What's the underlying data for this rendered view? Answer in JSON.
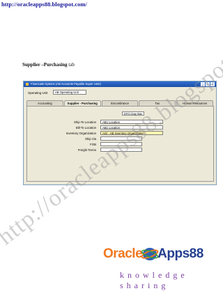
{
  "header": {
    "url": "http://oracleapps88.blogspot.com/"
  },
  "section": {
    "heading_bold": "Supplier –Purchasing",
    "heading_rest": "tab"
  },
  "window": {
    "title": "Financials Options (AB Accounts Payable Super User)",
    "operating_unit_label": "Operating Unit",
    "operating_unit_value": "AB Operating Unit",
    "tabs": [
      {
        "label": "Accounting"
      },
      {
        "label": "Supplier - Purchasing"
      },
      {
        "label": "Encumbrance"
      },
      {
        "label": "Tax"
      },
      {
        "label": "Human Resources"
      }
    ],
    "site_header": "EFO Only Site",
    "fields": [
      {
        "label": "Ship-To Location",
        "value": "AB1 Location"
      },
      {
        "label": "Bill-To Location",
        "value": "AB1 Location"
      },
      {
        "label": "Inventory Organization",
        "value": "AIO - AB Inventory Organization"
      },
      {
        "label": "Ship Via",
        "value": ""
      },
      {
        "label": "FOB",
        "value": ""
      },
      {
        "label": "Freight Terms",
        "value": ""
      }
    ]
  },
  "watermark": {
    "text": "http://oracleapps88.blogspot.com/"
  },
  "logo": {
    "oracle": "Oracle",
    "apps": "Apps88",
    "tagline": "knowledge sharing"
  },
  "colors": {
    "accent_orange": "#f07820",
    "brand_blue": "#233f8f",
    "tagline_purple": "#7a3fa0",
    "highlight": "#fff6b0"
  }
}
